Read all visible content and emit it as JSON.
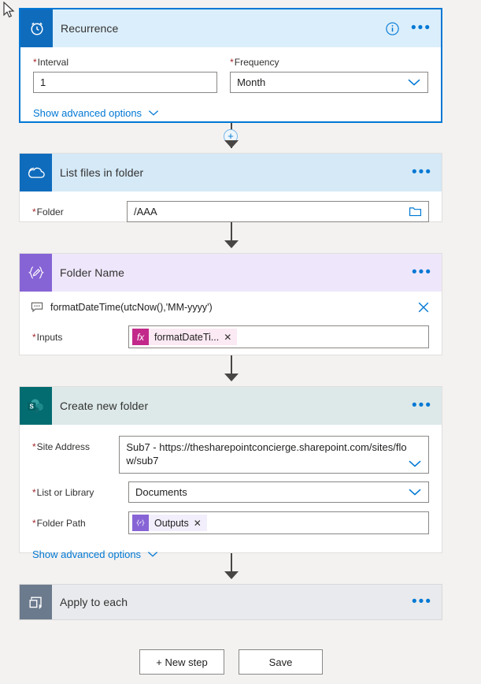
{
  "flow": {
    "steps": [
      {
        "id": "recurrence",
        "title": "Recurrence",
        "icon": "clock-icon",
        "selected": true,
        "fields": [
          {
            "label": "Interval",
            "required": true,
            "value": "1",
            "type": "text"
          },
          {
            "label": "Frequency",
            "required": true,
            "value": "Month",
            "type": "dropdown"
          }
        ],
        "advanced_label": "Show advanced options"
      },
      {
        "id": "list-files-in-folder",
        "title": "List files in folder",
        "icon": "onedrive-icon",
        "selected": false,
        "fields": [
          {
            "label": "Folder",
            "required": true,
            "value": "/AAA",
            "type": "folder-picker"
          }
        ]
      },
      {
        "id": "folder-name",
        "title": "Folder Name",
        "icon": "compose-icon",
        "selected": false,
        "comment": "formatDateTime(utcNow(),'MM-yyyy')",
        "fields": [
          {
            "label": "Inputs",
            "required": true,
            "token": "formatDateTi...",
            "token_type": "fx",
            "type": "token"
          }
        ]
      },
      {
        "id": "create-new-folder",
        "title": "Create new folder",
        "icon": "sharepoint-icon",
        "selected": false,
        "fields": [
          {
            "label": "Site Address",
            "required": true,
            "value": "Sub7 - https://thesharepointconcierge.sharepoint.com/sites/flow/sub7",
            "type": "dropdown-multiline"
          },
          {
            "label": "List or Library",
            "required": true,
            "value": "Documents",
            "type": "dropdown"
          },
          {
            "label": "Folder Path",
            "required": true,
            "token": "Outputs",
            "token_type": "compose",
            "type": "token"
          }
        ],
        "advanced_label": "Show advanced options"
      },
      {
        "id": "apply-to-each",
        "title": "Apply to each",
        "icon": "loop-icon",
        "selected": false,
        "collapsed": true
      }
    ]
  },
  "footer": {
    "new_step_label": "+ New step",
    "save_label": "Save"
  },
  "colors": {
    "accent": "#0078d4",
    "recurrence_header": "#dbeefb",
    "onedrive_header": "#d5e9f7",
    "compose_header": "#eee7fb",
    "sharepoint_header": "#dde9e9",
    "loop_header": "#e8eaed",
    "required_red": "#a4262c",
    "fx_badge": "#c2298a",
    "compose_badge": "#8764d5"
  }
}
